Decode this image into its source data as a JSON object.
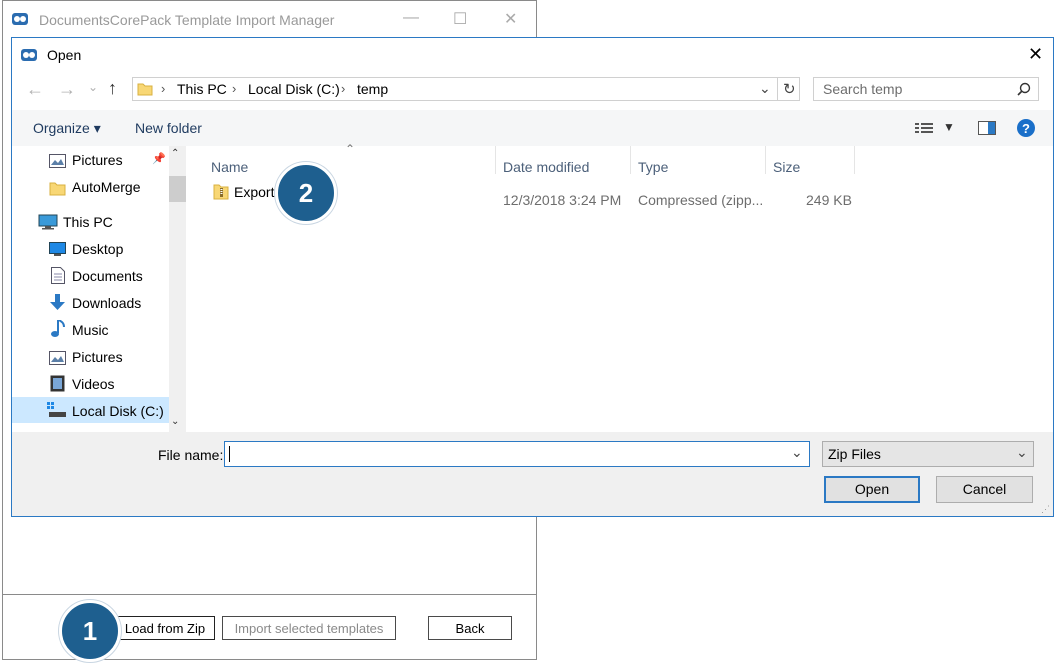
{
  "background_window": {
    "title": "DocumentsCorePack Template Import Manager",
    "buttons": {
      "load_from_zip": "Load from Zip",
      "import_selected": "Import selected templates",
      "back": "Back"
    },
    "controls": {
      "minimize": "—",
      "maximize": "☐",
      "close": "✕"
    }
  },
  "dialog": {
    "title": "Open",
    "close": "✕",
    "breadcrumb": [
      "This PC",
      "Local Disk (C:)",
      "temp"
    ],
    "breadcrumb_sep": "›",
    "search_placeholder": "Search temp",
    "toolbar": {
      "organize": "Organize ▾",
      "new_folder": "New folder"
    },
    "nav_items": [
      {
        "label": "Pictures",
        "icon": "pictures-icon"
      },
      {
        "label": "AutoMerge",
        "icon": "folder-icon"
      },
      {
        "label": "This PC",
        "icon": "computer-icon"
      },
      {
        "label": "Desktop",
        "icon": "desktop-icon"
      },
      {
        "label": "Documents",
        "icon": "documents-icon"
      },
      {
        "label": "Downloads",
        "icon": "downloads-icon"
      },
      {
        "label": "Music",
        "icon": "music-icon"
      },
      {
        "label": "Pictures",
        "icon": "pictures-icon"
      },
      {
        "label": "Videos",
        "icon": "videos-icon"
      },
      {
        "label": "Local Disk (C:)",
        "icon": "drive-icon",
        "selected": true
      }
    ],
    "columns": [
      "Name",
      "Date modified",
      "Type",
      "Size"
    ],
    "files": [
      {
        "name": "Export",
        "date": "12/3/2018 3:24 PM",
        "type": "Compressed (zipp...",
        "size": "249 KB"
      }
    ],
    "file_name_label": "File name:",
    "file_name_value": "",
    "filter": "Zip Files",
    "open_button": "Open",
    "cancel_button": "Cancel"
  },
  "annotations": {
    "step1": "1",
    "step2": "2"
  },
  "colors": {
    "accent": "#2b79c4",
    "badge": "#1e5f8f",
    "selection": "#cce8ff"
  }
}
